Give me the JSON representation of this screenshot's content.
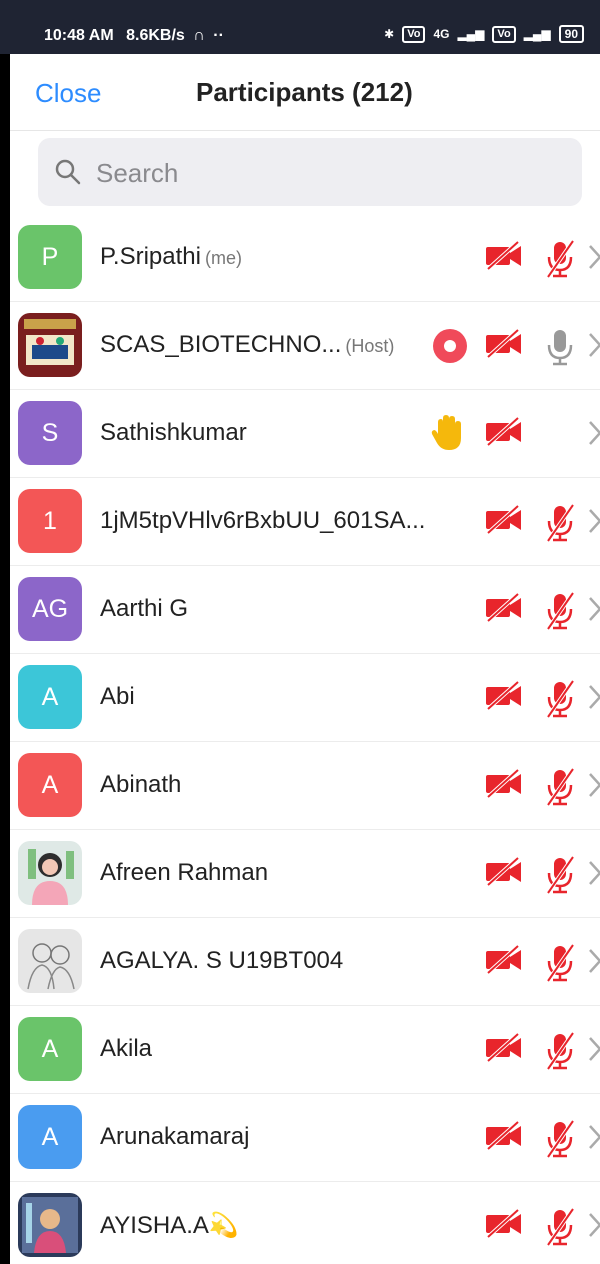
{
  "status_bar": {
    "time": "10:48 AM",
    "speed": "8.6KB/s",
    "network": "4G",
    "battery": "90"
  },
  "header": {
    "close_label": "Close",
    "title": "Participants (212)"
  },
  "search": {
    "placeholder": "Search"
  },
  "colors": {
    "accent": "#2d8cff",
    "muted": "#e8252c",
    "hand": "#f5b80c"
  },
  "participants": [
    {
      "name": "P.Sripathi",
      "tag": "(me)",
      "avatar_text": "P",
      "avatar_color": "#6ac46a",
      "video": "off",
      "mic": "muted"
    },
    {
      "name": "SCAS_BIOTECHNO...",
      "tag": "(Host)",
      "avatar_text": "",
      "avatar_image": "college-logo",
      "video": "off",
      "mic": "on",
      "recording": true
    },
    {
      "name": "Sathishkumar",
      "tag": "",
      "avatar_text": "S",
      "avatar_color": "#8c66c9",
      "video": "off",
      "mic": "none",
      "hand_raised": true
    },
    {
      "name": "1jM5tpVHlv6rBxbUU_601SA...",
      "tag": "",
      "avatar_text": "1",
      "avatar_color": "#f35656",
      "video": "off",
      "mic": "muted"
    },
    {
      "name": "Aarthi G",
      "tag": "",
      "avatar_text": "AG",
      "avatar_color": "#8c66c9",
      "video": "off",
      "mic": "muted"
    },
    {
      "name": "Abi",
      "tag": "",
      "avatar_text": "A",
      "avatar_color": "#3cc6d8",
      "video": "off",
      "mic": "muted"
    },
    {
      "name": "Abinath",
      "tag": "",
      "avatar_text": "A",
      "avatar_color": "#f35656",
      "video": "off",
      "mic": "muted"
    },
    {
      "name": "Afreen Rahman",
      "tag": "",
      "avatar_text": "",
      "avatar_image": "profile-photo",
      "video": "off",
      "mic": "muted"
    },
    {
      "name": "AGALYA. S U19BT004",
      "tag": "",
      "avatar_text": "",
      "avatar_image": "sketch-photo",
      "video": "off",
      "mic": "muted"
    },
    {
      "name": "Akila",
      "tag": "",
      "avatar_text": "A",
      "avatar_color": "#6ac46a",
      "video": "off",
      "mic": "muted"
    },
    {
      "name": "Arunakamaraj",
      "tag": "",
      "avatar_text": "A",
      "avatar_color": "#4a9cf0",
      "video": "off",
      "mic": "muted"
    },
    {
      "name": "AYISHA.A💫",
      "tag": "",
      "avatar_text": "",
      "avatar_image": "art-photo",
      "video": "off",
      "mic": "muted"
    }
  ]
}
